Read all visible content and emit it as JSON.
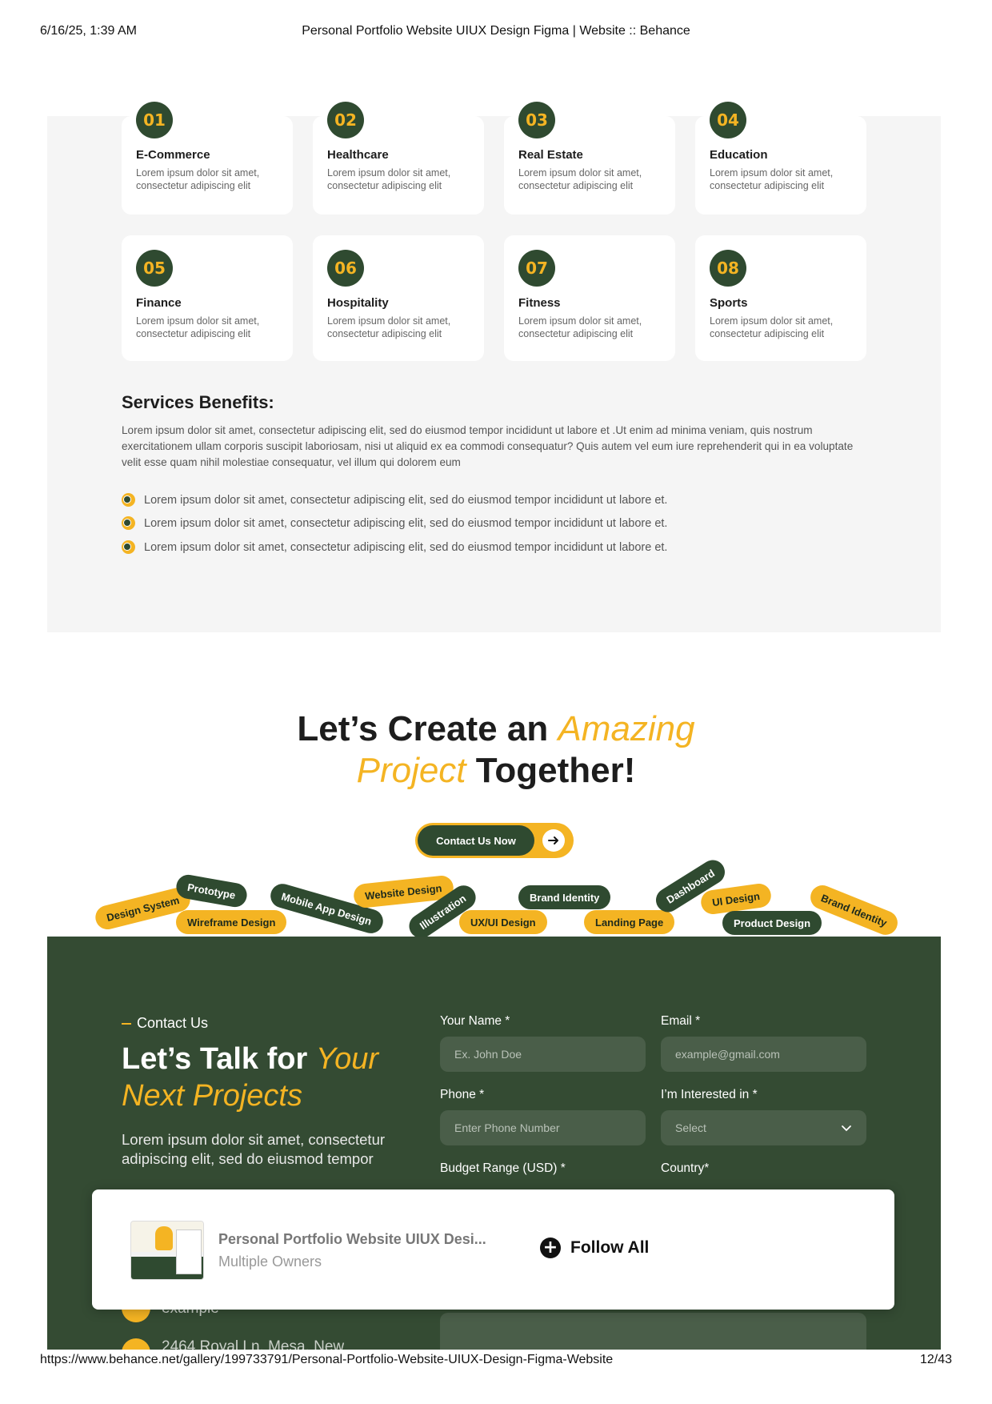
{
  "print_header": {
    "datetime": "6/16/25, 1:39 AM",
    "title": "Personal Portfolio Website UIUX Design Figma | Website :: Behance"
  },
  "print_footer": {
    "url": "https://www.behance.net/gallery/199733791/Personal-Portfolio-Website-UIUX-Design-Figma-Website",
    "page": "12/43"
  },
  "services": [
    {
      "num": "01",
      "title": "E-Commerce",
      "desc": "Lorem ipsum dolor sit amet, consectetur adipiscing elit"
    },
    {
      "num": "02",
      "title": "Healthcare",
      "desc": "Lorem ipsum dolor sit amet, consectetur adipiscing elit"
    },
    {
      "num": "03",
      "title": "Real Estate",
      "desc": "Lorem ipsum dolor sit amet, consectetur adipiscing elit"
    },
    {
      "num": "04",
      "title": "Education",
      "desc": "Lorem ipsum dolor sit amet, consectetur adipiscing elit"
    },
    {
      "num": "05",
      "title": "Finance",
      "desc": "Lorem ipsum dolor sit amet, consectetur adipiscing elit"
    },
    {
      "num": "06",
      "title": "Hospitality",
      "desc": "Lorem ipsum dolor sit amet, consectetur adipiscing elit"
    },
    {
      "num": "07",
      "title": "Fitness",
      "desc": "Lorem ipsum dolor sit amet, consectetur adipiscing elit"
    },
    {
      "num": "08",
      "title": "Sports",
      "desc": "Lorem ipsum dolor sit amet, consectetur adipiscing elit"
    }
  ],
  "benefits": {
    "heading": "Services Benefits:",
    "paragraph": "Lorem ipsum dolor sit amet, consectetur adipiscing elit, sed do eiusmod tempor incididunt ut labore et .Ut enim ad minima veniam, quis nostrum exercitationem ullam corporis suscipit laboriosam, nisi ut aliquid ex ea commodi consequatur? Quis autem vel eum iure reprehenderit qui in ea voluptate velit esse quam nihil molestiae consequatur, vel illum qui dolorem eum",
    "items": [
      "Lorem ipsum dolor sit amet, consectetur adipiscing elit, sed do eiusmod tempor incididunt ut labore et.",
      "Lorem ipsum dolor sit amet, consectetur adipiscing elit, sed do eiusmod tempor incididunt ut labore et.",
      "Lorem ipsum dolor sit amet, consectetur adipiscing elit, sed do eiusmod tempor incididunt ut labore et."
    ]
  },
  "cta": {
    "line1_a": "Let’s Create an",
    "line1_accent": "Amazing",
    "line2_accent": "Project",
    "line2_b": "Together!",
    "button_label": "Contact Us Now"
  },
  "tags": {
    "design_system": "Design System",
    "prototype": "Prototype",
    "wireframe": "Wireframe Design",
    "mobile_app": "Mobile App Design",
    "website_design": "Website Design",
    "illustration": "Illustration",
    "uxui": "UX/UI Design",
    "brand_identity_g": "Brand Identity",
    "landing_page": "Landing Page",
    "dashboard": "Dashboard",
    "ui_design": "UI Design",
    "product_design": "Product Design",
    "brand_identity_y": "Brand Identity"
  },
  "contact": {
    "label": "Contact Us",
    "title_a": "Let’s Talk for",
    "title_accent_1": "Your",
    "title_accent_2": "Next Projects",
    "description": "Lorem ipsum dolor sit amet, consectetur adipiscing elit, sed do eiusmod tempor",
    "fields": {
      "name_label": "Your Name *",
      "name_placeholder": "Ex. John Doe",
      "email_label": "Email *",
      "email_placeholder": "example@gmail.com",
      "phone_label": "Phone *",
      "phone_placeholder": "Enter Phone Number",
      "interest_label": "I’m Interested in *",
      "interest_value": "Select",
      "budget_label": "Budget Range (USD) *",
      "country_label": "Country*"
    },
    "partial_1": "example",
    "partial_2": "2464 Royal Ln. Mesa, New"
  },
  "overlay": {
    "title": "Personal Portfolio Website UIUX Desi...",
    "subtitle": "Multiple Owners",
    "follow_label": "Follow All"
  },
  "colors": {
    "dark_green": "#2f4a30",
    "accent_yellow": "#f4b423",
    "section_bg": "#f5f5f5"
  }
}
